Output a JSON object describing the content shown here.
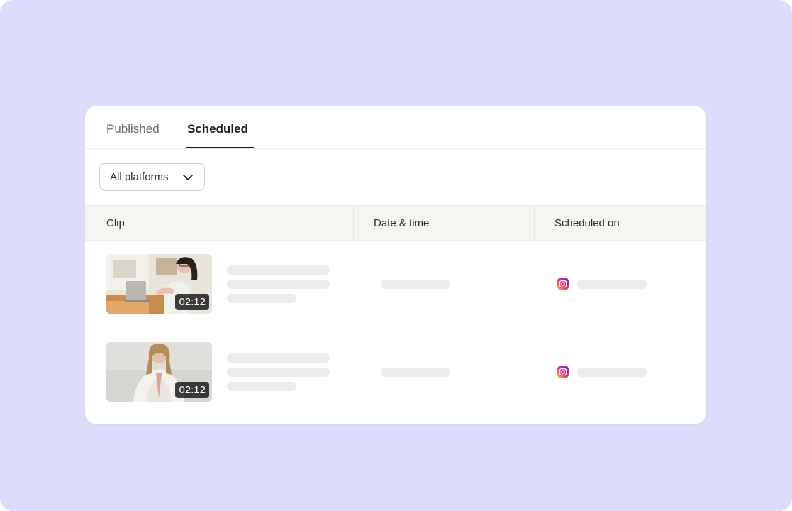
{
  "tabs": [
    {
      "label": "Published",
      "active": false
    },
    {
      "label": "Scheduled",
      "active": true
    }
  ],
  "filter": {
    "selected": "All platforms"
  },
  "table": {
    "columns": [
      "Clip",
      "Date & time",
      "Scheduled on"
    ],
    "rows": [
      {
        "duration": "02:12",
        "platform_icon": "instagram-icon"
      },
      {
        "duration": "02:12",
        "platform_icon": "instagram-icon"
      }
    ]
  },
  "colors": {
    "background": "#dcdcfd",
    "card": "#ffffff",
    "header_bg": "#f5f5f2",
    "placeholder": "#ececec",
    "active_tab": "#1f1f1f"
  }
}
